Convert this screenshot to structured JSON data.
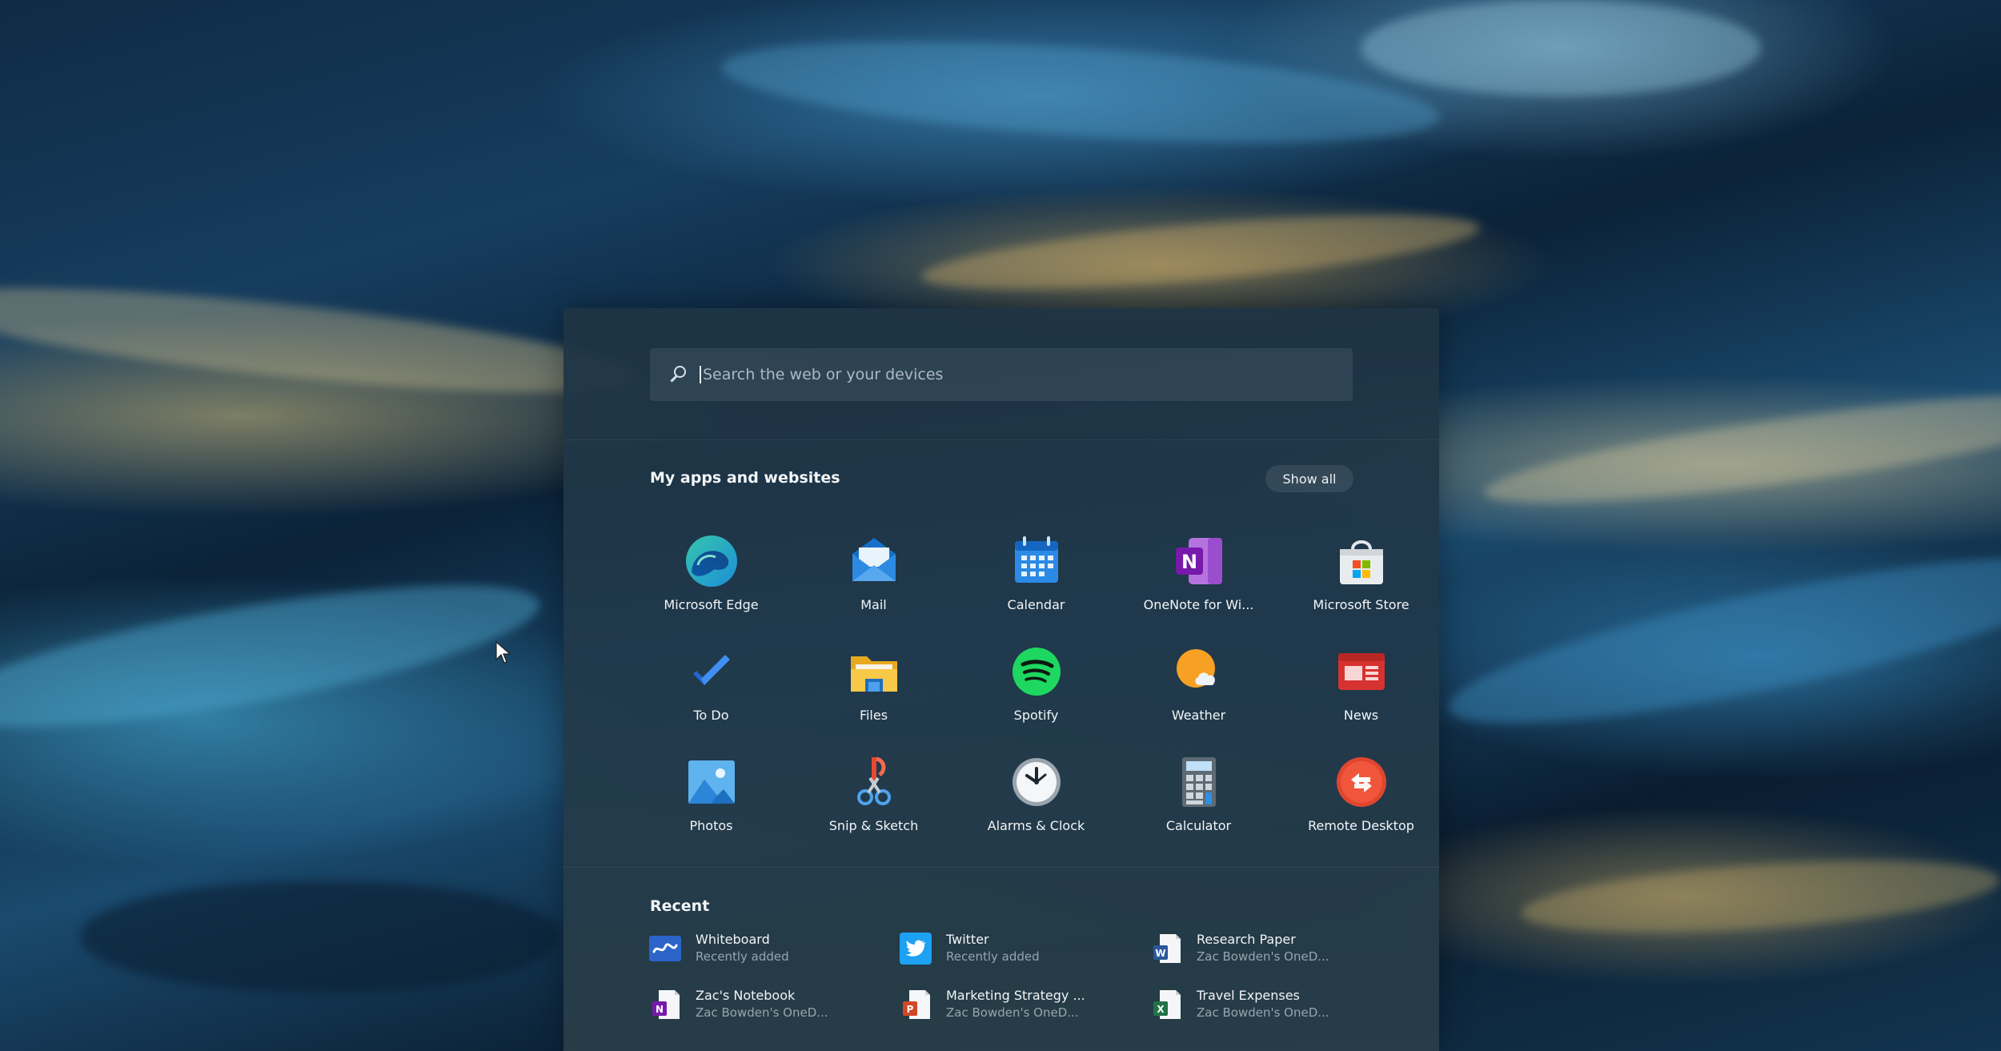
{
  "search": {
    "placeholder": "Search the web or your devices"
  },
  "apps_section": {
    "title": "My apps and websites",
    "show_all_label": "Show all",
    "apps": [
      {
        "label": "Microsoft Edge",
        "icon": "edge-icon"
      },
      {
        "label": "Mail",
        "icon": "mail-icon"
      },
      {
        "label": "Calendar",
        "icon": "calendar-icon"
      },
      {
        "label": "OneNote for Wi...",
        "icon": "onenote-icon"
      },
      {
        "label": "Microsoft Store",
        "icon": "store-icon"
      },
      {
        "label": "To Do",
        "icon": "todo-icon"
      },
      {
        "label": "Files",
        "icon": "files-icon"
      },
      {
        "label": "Spotify",
        "icon": "spotify-icon"
      },
      {
        "label": "Weather",
        "icon": "weather-icon"
      },
      {
        "label": "News",
        "icon": "news-icon"
      },
      {
        "label": "Photos",
        "icon": "photos-icon"
      },
      {
        "label": "Snip & Sketch",
        "icon": "snip-sketch-icon"
      },
      {
        "label": "Alarms & Clock",
        "icon": "alarms-clock-icon"
      },
      {
        "label": "Calculator",
        "icon": "calculator-icon"
      },
      {
        "label": "Remote Desktop",
        "icon": "remote-desktop-icon"
      }
    ]
  },
  "recent_section": {
    "title": "Recent",
    "items": [
      {
        "name": "Whiteboard",
        "sub": "Recently added",
        "icon": "whiteboard-icon"
      },
      {
        "name": "Twitter",
        "sub": "Recently added",
        "icon": "twitter-icon"
      },
      {
        "name": "Research Paper",
        "sub": "Zac Bowden's OneD...",
        "icon": "word-doc-icon"
      },
      {
        "name": "Zac's Notebook",
        "sub": "Zac Bowden's OneD...",
        "icon": "onenote-notebook-icon"
      },
      {
        "name": "Marketing Strategy ...",
        "sub": "Zac Bowden's OneD...",
        "icon": "powerpoint-icon"
      },
      {
        "name": "Travel Expenses",
        "sub": "Zac Bowden's OneD...",
        "icon": "excel-icon"
      }
    ]
  },
  "colors": {
    "panel": "#223a4c",
    "accent": "#0078d4"
  }
}
